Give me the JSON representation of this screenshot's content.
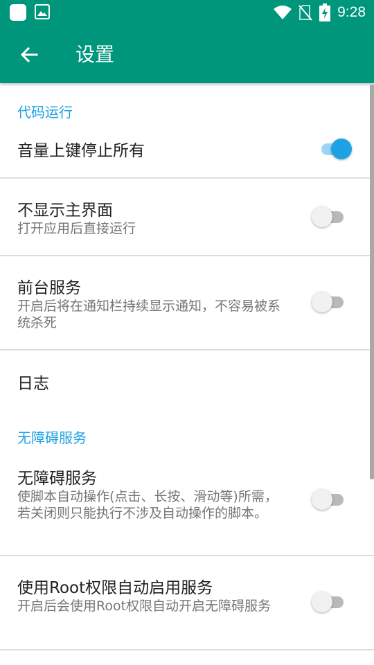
{
  "status_bar": {
    "time": "9:28"
  },
  "app_bar": {
    "title": "设置"
  },
  "sections": [
    {
      "header": "代码运行"
    },
    {
      "header": "无障碍服务"
    }
  ],
  "prefs": {
    "volume_stop": {
      "title": "音量上键停止所有",
      "checked": true
    },
    "hide_main": {
      "title": "不显示主界面",
      "summary": "打开应用后直接运行",
      "checked": false
    },
    "foreground": {
      "title": "前台服务",
      "summary": "开启后将在通知栏持续显示通知，不容易被系统杀死",
      "checked": false
    },
    "log": {
      "title": "日志"
    },
    "accessibility": {
      "title": "无障碍服务",
      "summary": "使脚本自动操作(点击、长按、滑动等)所需，若关闭则只能执行不涉及自动操作的脚本。",
      "checked": false
    },
    "root_enable": {
      "title": "使用Root权限自动启用服务",
      "summary": "开启后会使用Root权限自动开启无障碍服务",
      "checked": false
    }
  }
}
